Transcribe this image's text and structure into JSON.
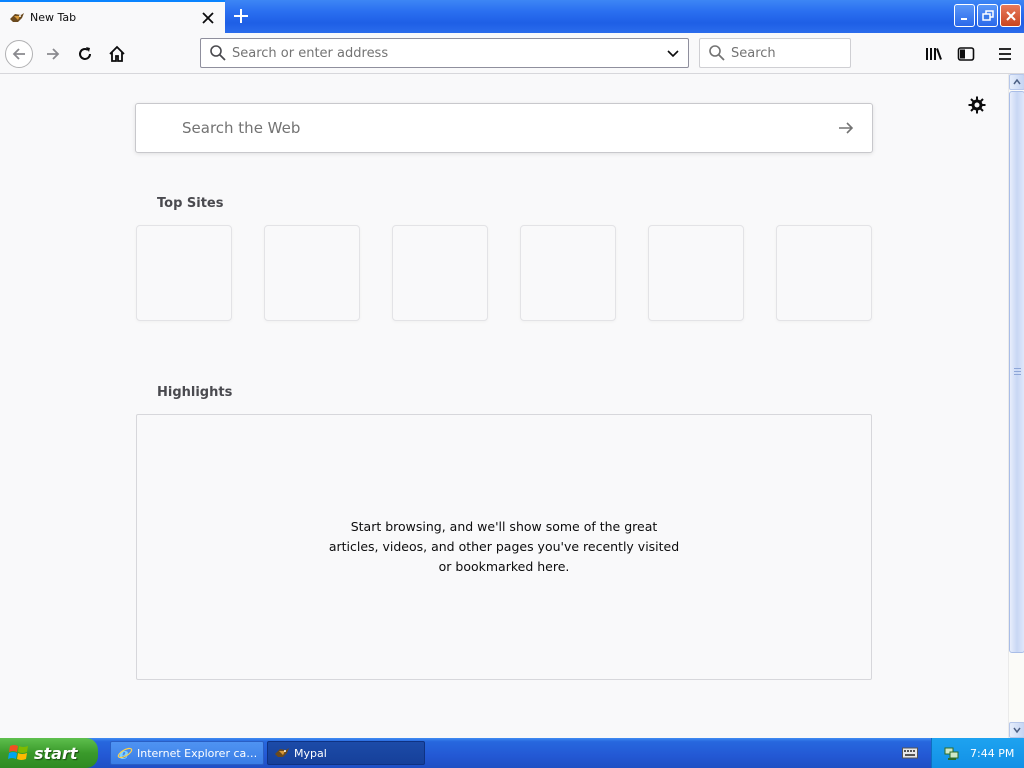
{
  "tab": {
    "title": "New Tab"
  },
  "navbar": {
    "url_placeholder": "Search or enter address",
    "search_placeholder": "Search"
  },
  "content": {
    "websearch_placeholder": "Search the Web",
    "top_sites_title": "Top Sites",
    "top_sites_count": 6,
    "highlights_title": "Highlights",
    "highlights_message": "Start browsing, and we'll show some of the great articles, videos, and other pages you've recently visited or bookmarked here."
  },
  "taskbar": {
    "start_label": "start",
    "items": [
      {
        "label": "Internet Explorer can..."
      },
      {
        "label": "Mypal"
      }
    ],
    "clock": "7:44 PM"
  },
  "colors": {
    "accent": "#0a84ff",
    "xp_blue": "#2358d4",
    "start_green": "#3a9a2b",
    "page_bg": "#f9f9fa"
  }
}
